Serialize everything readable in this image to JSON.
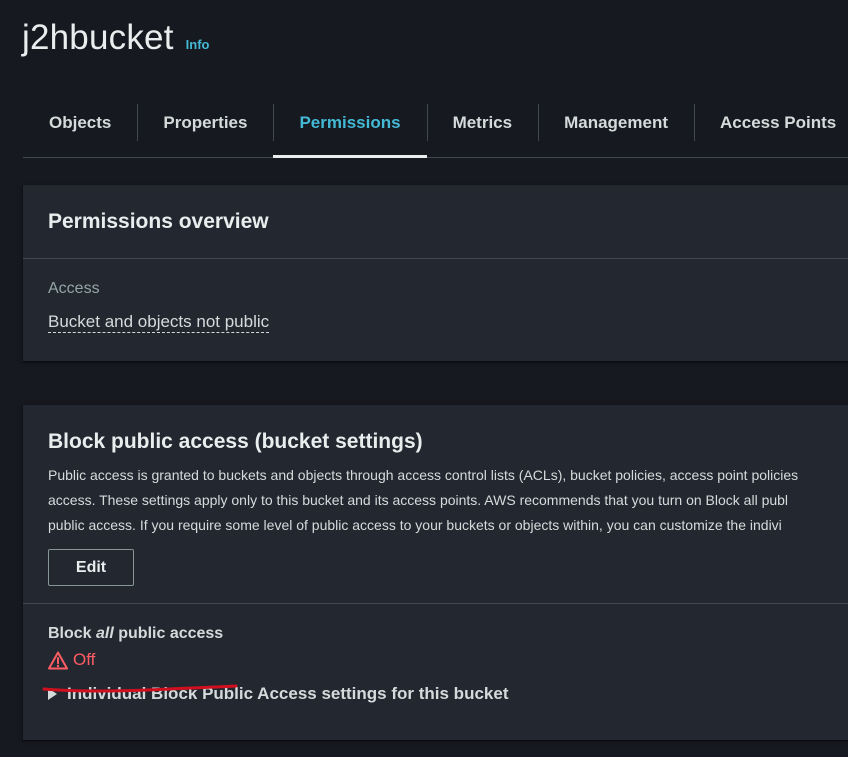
{
  "header": {
    "bucket_name": "j2hbucket",
    "info_label": "Info"
  },
  "tabs": [
    {
      "label": "Objects",
      "active": false
    },
    {
      "label": "Properties",
      "active": false
    },
    {
      "label": "Permissions",
      "active": true
    },
    {
      "label": "Metrics",
      "active": false
    },
    {
      "label": "Management",
      "active": false
    },
    {
      "label": "Access Points",
      "active": false
    }
  ],
  "permissions_overview": {
    "title": "Permissions overview",
    "access_label": "Access",
    "access_value": "Bucket and objects not public"
  },
  "block_public_access": {
    "title": "Block public access (bucket settings)",
    "description_lines": [
      "Public access is granted to buckets and objects through access control lists (ACLs), bucket policies, access point policies",
      "access. These settings apply only to this bucket and its access points. AWS recommends that you turn on Block all publ",
      "public access. If you require some level of public access to your buckets or objects within, you can customize the indivi"
    ],
    "edit_label": "Edit",
    "block_all_prefix": "Block ",
    "block_all_em": "all",
    "block_all_suffix": " public access",
    "status_text": "Off",
    "status_icon": "warning-icon",
    "expander_label": "Individual Block Public Access settings for this bucket"
  },
  "colors": {
    "background": "#16191f",
    "panel": "#232730",
    "accent": "#44b9d6",
    "warning": "#ff5d64",
    "annotation": "#d0101e"
  }
}
